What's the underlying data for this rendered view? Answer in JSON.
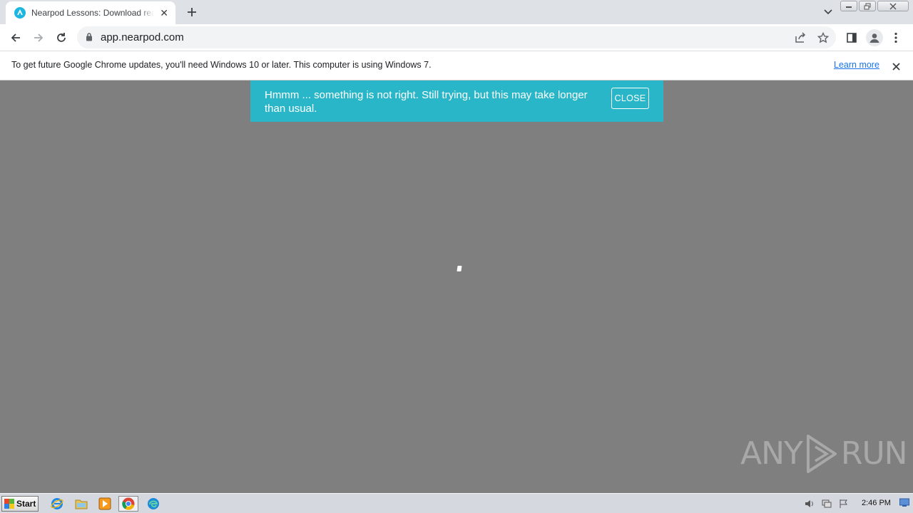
{
  "browser": {
    "tab": {
      "title": "Nearpod Lessons: Download ready-to",
      "favicon": "nearpod-logo-icon",
      "close_glyph": "✕"
    },
    "new_tab_glyph": "+",
    "url": "app.nearpod.com"
  },
  "infobar": {
    "message": "To get future Google Chrome updates, you'll need Windows 10 or later. This computer is using Windows 7.",
    "link": "Learn more"
  },
  "page": {
    "alert_message": "Hmmm ... something is not right. Still trying, but this may take longer than usual.",
    "alert_close": "CLOSE",
    "alert_color": "#2ab6c9",
    "background_color": "#7f7f7f"
  },
  "watermark": {
    "left": "ANY",
    "right": "RUN"
  },
  "taskbar": {
    "start_label": "Start",
    "apps": [
      "internet-explorer-icon",
      "folder-icon",
      "media-player-icon",
      "chrome-icon",
      "edge-icon"
    ],
    "clock": "2:46 PM"
  }
}
